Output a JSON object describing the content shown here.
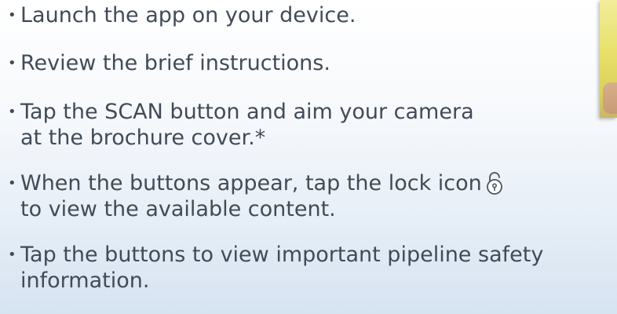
{
  "instructions": {
    "bullet": "•",
    "items": [
      {
        "line1": "Launch the app on your device."
      },
      {
        "line1": "Review the brief instructions."
      },
      {
        "line1": "Tap the SCAN button and aim your camera",
        "line2": "at the brochure cover.*"
      },
      {
        "line1": "When the buttons appear, tap the lock icon",
        "line2": "to view the available content.",
        "icon": "lock-icon"
      },
      {
        "line1": "Tap the buttons to view important pipeline safety",
        "line2": "information."
      }
    ]
  },
  "colors": {
    "text": "#414b57",
    "background_top": "#ffffff",
    "background_bottom": "#d6e3f1"
  }
}
